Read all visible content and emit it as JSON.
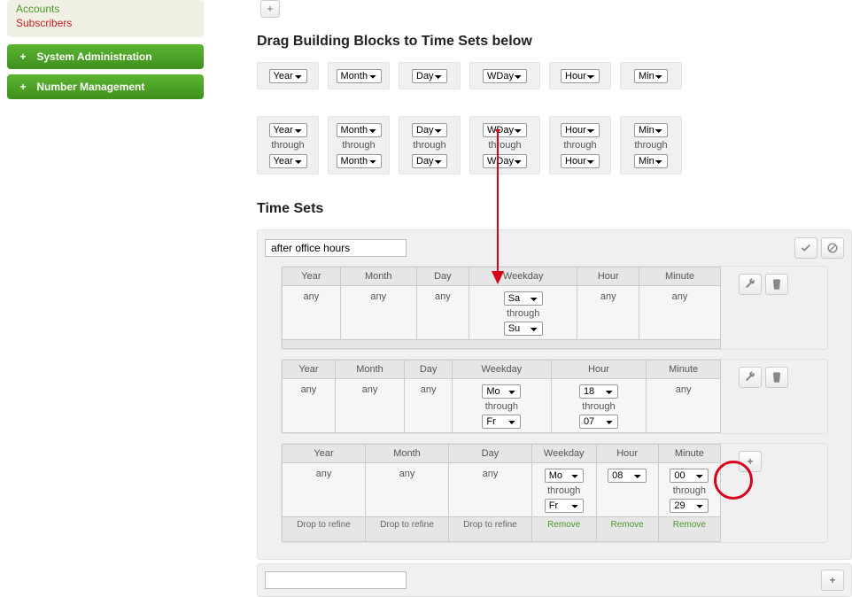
{
  "sidebar": {
    "links": [
      {
        "label": "Accounts",
        "cls": "green-link"
      },
      {
        "label": "Subscribers",
        "cls": "red-link"
      }
    ],
    "buttons": [
      {
        "label": "System Administration"
      },
      {
        "label": "Number Management"
      }
    ]
  },
  "headings": {
    "blocks": "Drag Building Blocks to Time Sets below",
    "timesets": "Time Sets"
  },
  "through_label": "through",
  "block_units": [
    "Year",
    "Month",
    "Day",
    "WDay",
    "Hour",
    "Min"
  ],
  "columns": [
    "Year",
    "Month",
    "Day",
    "Weekday",
    "Hour",
    "Minute"
  ],
  "any_label": "any",
  "drop_label": "Drop to refine",
  "remove_label": "Remove",
  "timeset_name": "after office hours",
  "rules": {
    "r1": {
      "year": "any",
      "month": "any",
      "day": "any",
      "hour": "any",
      "minute": "any",
      "wday_from": "Sa",
      "wday_to": "Su"
    },
    "r2": {
      "year": "any",
      "month": "any",
      "day": "any",
      "minute": "any",
      "wday_from": "Mo",
      "wday_to": "Fr",
      "hour_from": "18",
      "hour_to": "07"
    },
    "r3": {
      "year": "any",
      "month": "any",
      "day": "any",
      "wday_from": "Mo",
      "wday_to": "Fr",
      "hour_from": "08",
      "min_from": "00",
      "min_to": "29"
    }
  }
}
